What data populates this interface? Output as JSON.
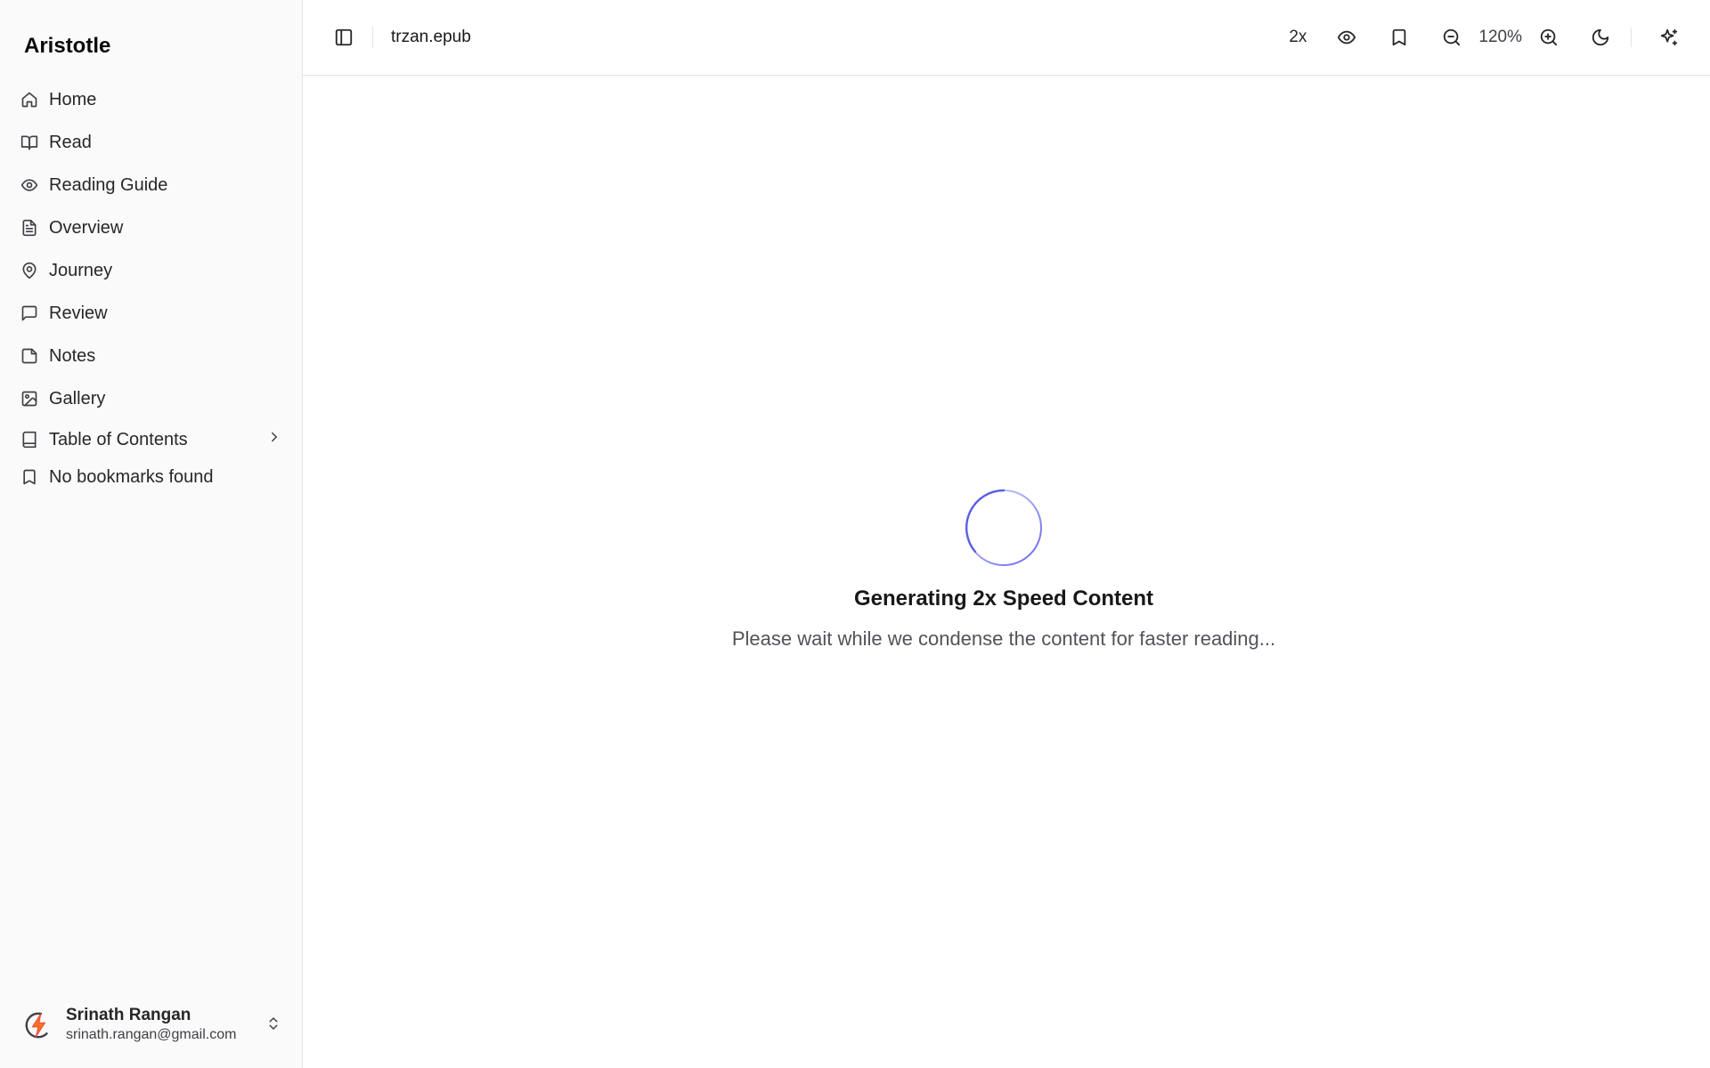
{
  "sidebar": {
    "brand": "Aristotle",
    "items": [
      {
        "label": "Home",
        "icon": "home-icon"
      },
      {
        "label": "Read",
        "icon": "book-open-icon"
      },
      {
        "label": "Reading Guide",
        "icon": "eye-icon"
      },
      {
        "label": "Overview",
        "icon": "file-text-icon"
      },
      {
        "label": "Journey",
        "icon": "map-pin-icon"
      },
      {
        "label": "Review",
        "icon": "message-square-icon"
      },
      {
        "label": "Notes",
        "icon": "sticky-note-icon"
      },
      {
        "label": "Gallery",
        "icon": "image-icon"
      }
    ],
    "toc": {
      "label": "Table of Contents",
      "icon": "book-icon"
    },
    "bookmarks": {
      "label": "No bookmarks found",
      "icon": "bookmark-icon"
    },
    "user": {
      "name": "Srinath Rangan",
      "email": "srinath.rangan@gmail.com",
      "avatar_colors": [
        "#ef4444",
        "#f97316",
        "#3f3f46"
      ]
    }
  },
  "topbar": {
    "filename": "trzan.epub",
    "speed_label": "2x",
    "zoom_label": "120%"
  },
  "content": {
    "title": "Generating 2x Speed Content",
    "subtitle": "Please wait while we condense the content for faster reading...",
    "spinner_color": "#6366f1"
  }
}
